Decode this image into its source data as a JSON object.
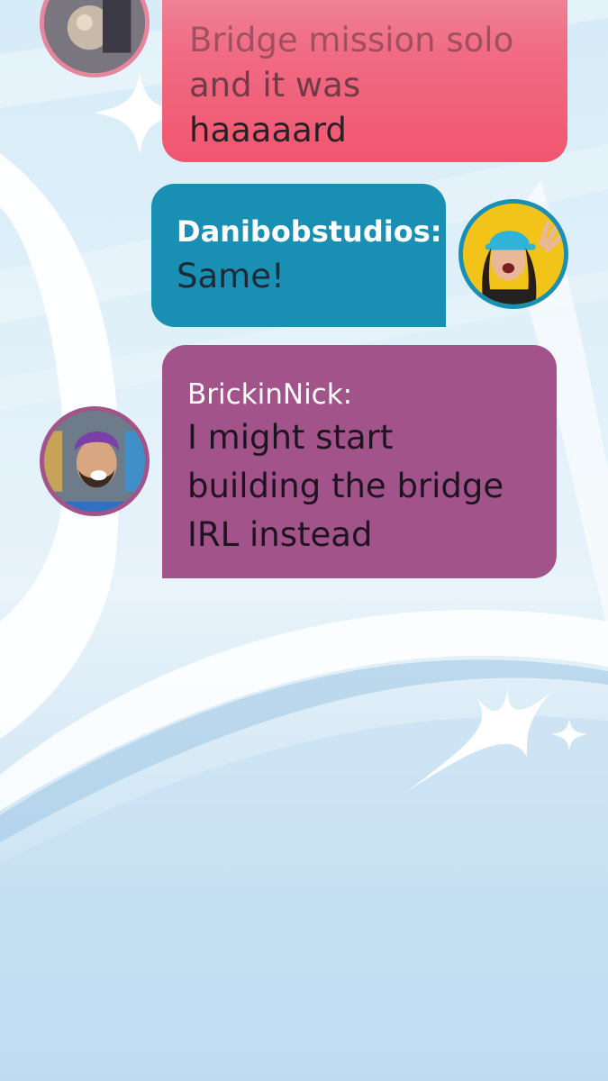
{
  "conversation": {
    "messages": [
      {
        "sender": "",
        "text_lines": [
          "Bridge mission solo",
          "and it was",
          "haaaaard"
        ],
        "bubble_color": "#f1566f",
        "avatar": "player-avatar-icon"
      },
      {
        "sender": "Danibobstudios:",
        "text": "Same!",
        "bubble_color": "#1a8fb4",
        "avatar": "danibobstudios-avatar"
      },
      {
        "sender": "BrickinNick:",
        "text_lines": [
          "I might start",
          "building the bridge",
          "IRL instead"
        ],
        "bubble_color": "#a2548a",
        "avatar": "brickinnick-avatar"
      }
    ]
  },
  "theme": {
    "background": "#bcdcf0",
    "sparkle_color": "#ffffff"
  }
}
